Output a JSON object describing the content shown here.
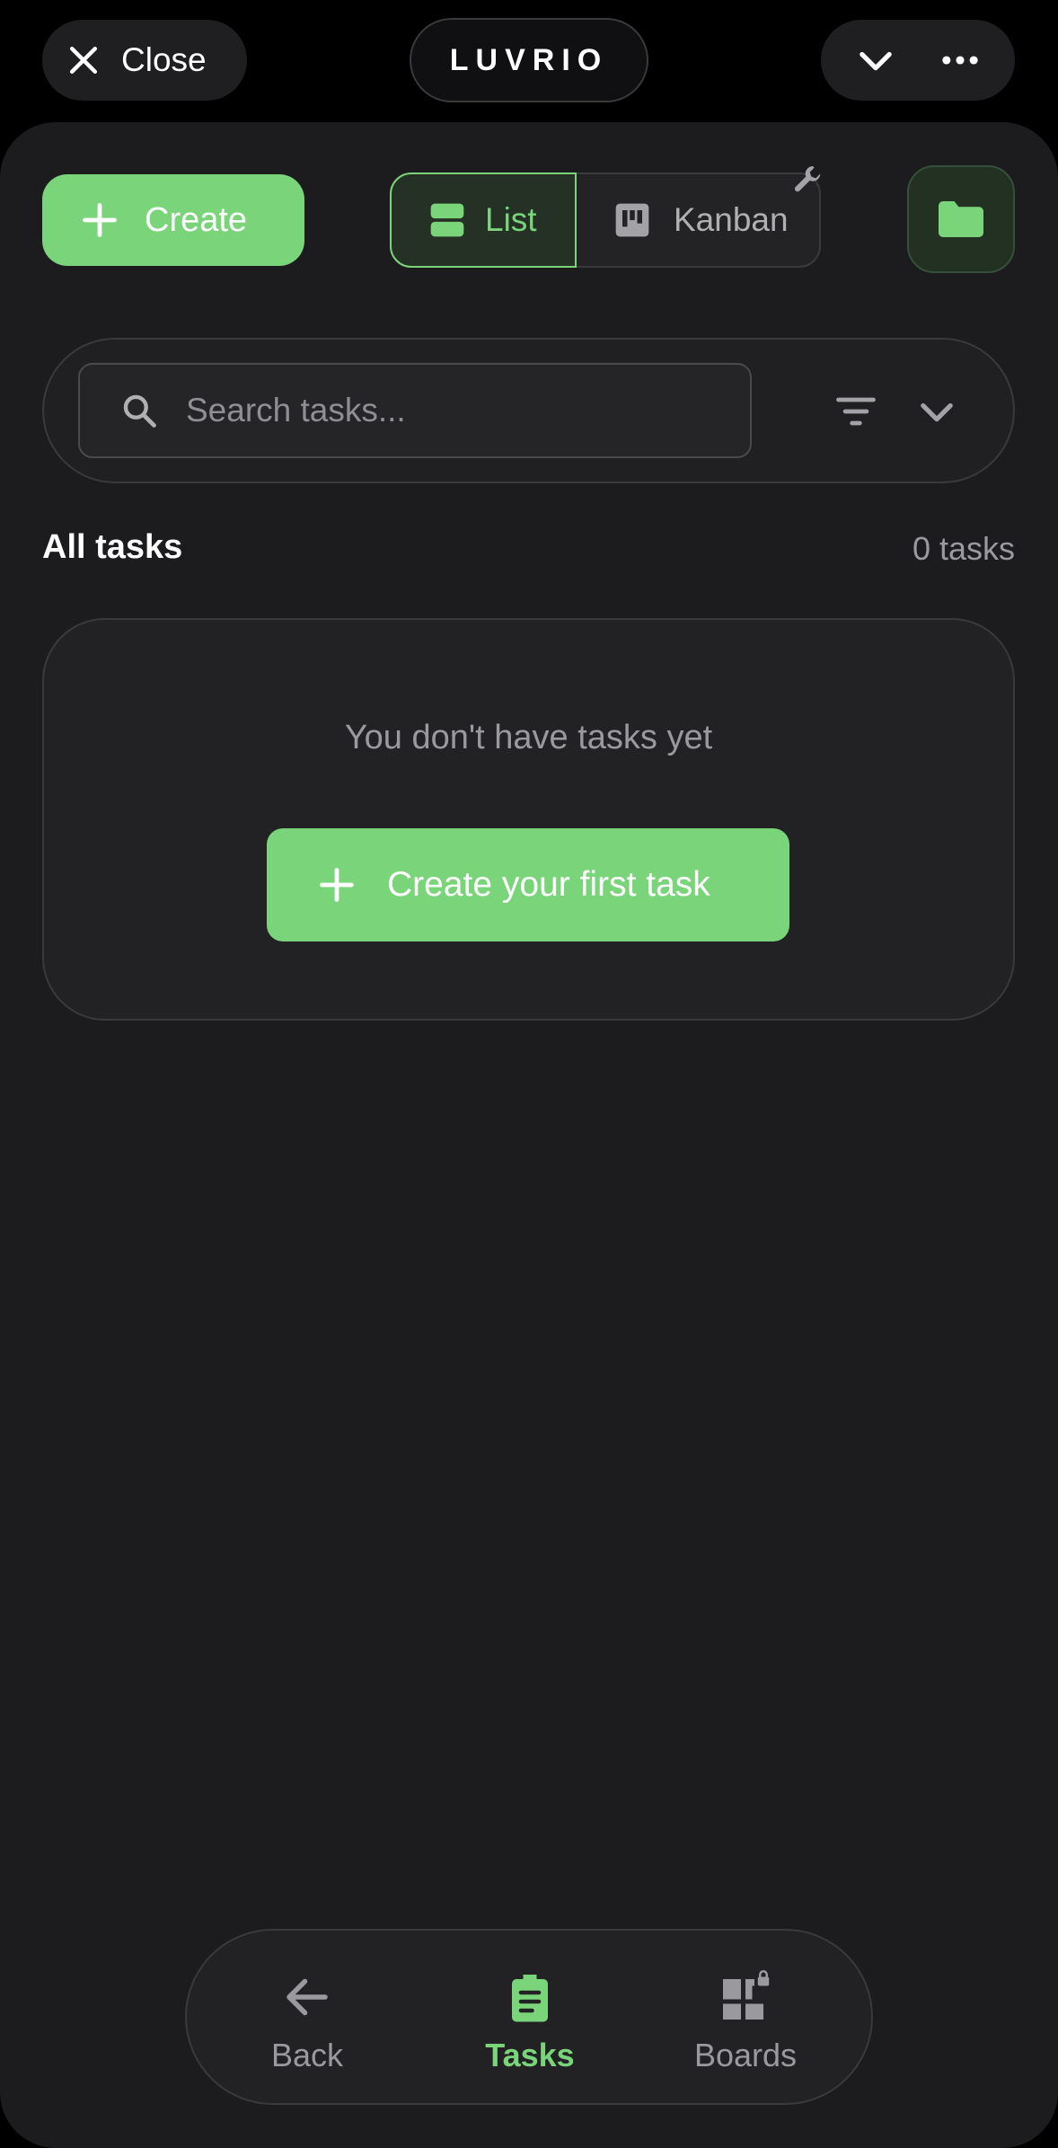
{
  "topbar": {
    "close_label": "Close",
    "brand": "LUVRIO"
  },
  "toolbar": {
    "create_label": "Create",
    "list_label": "List",
    "kanban_label": "Kanban"
  },
  "search": {
    "placeholder": "Search tasks...",
    "value": ""
  },
  "section": {
    "title": "All tasks",
    "count": "0 tasks"
  },
  "empty_state": {
    "message": "You don't have tasks yet",
    "button_label": "Create your first task"
  },
  "bottom_nav": {
    "back_label": "Back",
    "tasks_label": "Tasks",
    "boards_label": "Boards"
  },
  "colors": {
    "accent": "#7ad47a",
    "background": "#1c1c1e",
    "muted_text": "#9a9a9e"
  },
  "icons": [
    "close-icon",
    "chevron-down-icon",
    "more-icon",
    "plus-icon",
    "list-view-icon",
    "kanban-icon",
    "wrench-icon",
    "folder-icon",
    "search-icon",
    "filter-icon",
    "back-arrow-icon",
    "clipboard-icon",
    "boards-locked-icon"
  ]
}
